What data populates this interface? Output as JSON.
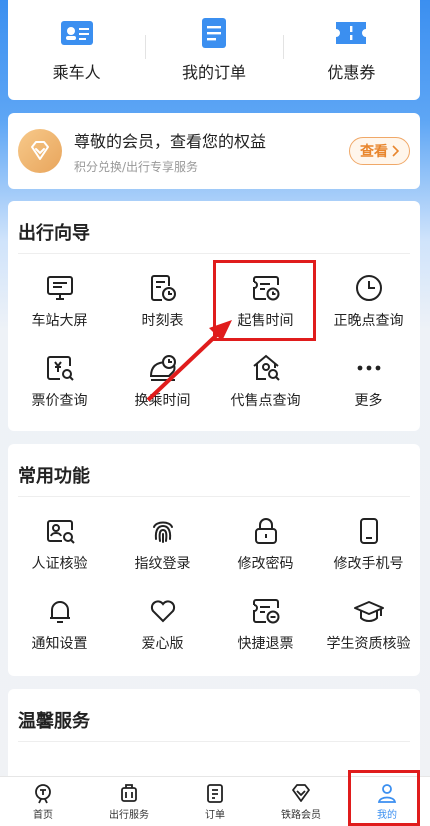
{
  "top_shortcuts": [
    {
      "label": "乘车人",
      "icon": "id-card-icon"
    },
    {
      "label": "我的订单",
      "icon": "order-icon"
    },
    {
      "label": "优惠券",
      "icon": "coupon-icon"
    }
  ],
  "member": {
    "title": "尊敬的会员，查看您的权益",
    "subtitle": "积分兑换/出行专享服务",
    "button": "查看"
  },
  "guide": {
    "title": "出行向导",
    "items": [
      {
        "label": "车站大屏",
        "icon": "monitor-icon"
      },
      {
        "label": "时刻表",
        "icon": "timetable-icon"
      },
      {
        "label": "起售时间",
        "icon": "sale-time-icon"
      },
      {
        "label": "正晚点查询",
        "icon": "clock-icon"
      },
      {
        "label": "票价查询",
        "icon": "price-search-icon"
      },
      {
        "label": "换乘时间",
        "icon": "transfer-icon"
      },
      {
        "label": "代售点查询",
        "icon": "agency-icon"
      },
      {
        "label": "更多",
        "icon": "more-icon"
      }
    ]
  },
  "common": {
    "title": "常用功能",
    "items": [
      {
        "label": "人证核验",
        "icon": "id-verify-icon"
      },
      {
        "label": "指纹登录",
        "icon": "fingerprint-icon"
      },
      {
        "label": "修改密码",
        "icon": "lock-icon"
      },
      {
        "label": "修改手机号",
        "icon": "phone-icon"
      },
      {
        "label": "通知设置",
        "icon": "bell-icon"
      },
      {
        "label": "爱心版",
        "icon": "heart-icon"
      },
      {
        "label": "快捷退票",
        "icon": "refund-icon"
      },
      {
        "label": "学生资质核验",
        "icon": "graduation-cap-icon"
      }
    ]
  },
  "warm": {
    "title": "温馨服务"
  },
  "bottom_nav": [
    {
      "label": "首页",
      "icon": "home-icon"
    },
    {
      "label": "出行服务",
      "icon": "luggage-icon"
    },
    {
      "label": "订单",
      "icon": "order-list-icon"
    },
    {
      "label": "铁路会员",
      "icon": "member-icon"
    },
    {
      "label": "我的",
      "icon": "user-icon",
      "active": true
    }
  ],
  "colors": {
    "accent": "#3b8ff0",
    "annotation": "#e01c1c",
    "member_orange": "#e8862e"
  }
}
